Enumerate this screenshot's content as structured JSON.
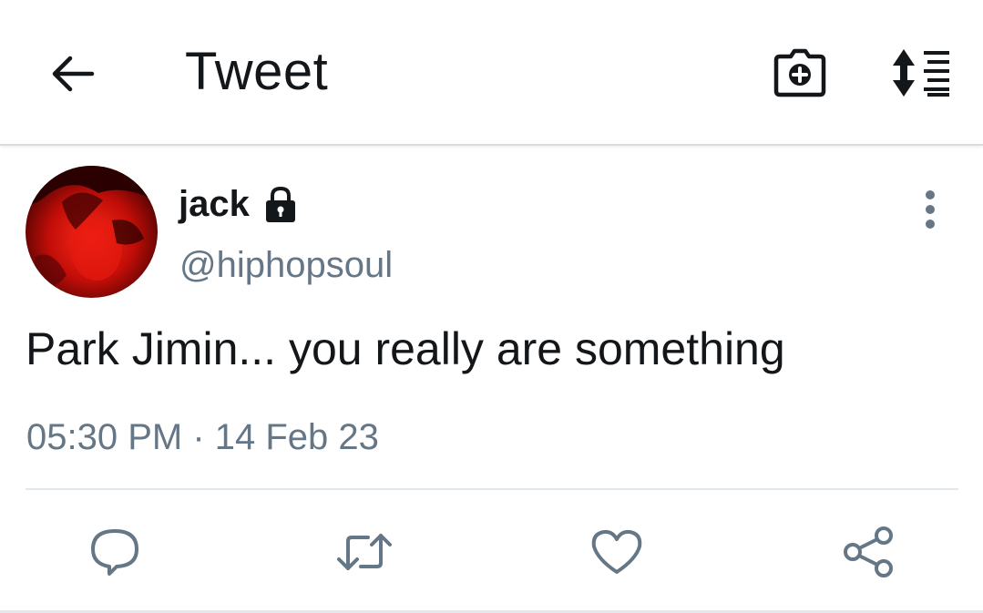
{
  "header": {
    "title": "Tweet",
    "back_icon": "arrow-left-icon",
    "camera_icon": "camera-add-icon",
    "sort_icon": "sort-lines-icon"
  },
  "tweet": {
    "author_name": "jack",
    "protected_icon": "lock-icon",
    "handle": "@hiphopsoul",
    "text": "Park Jimin... you really are something",
    "timestamp": "05:30 PM · 14 Feb 23",
    "more_icon": "vertical-dots-icon"
  },
  "actions": {
    "reply_icon": "reply-bubble-icon",
    "retweet_icon": "retweet-icon",
    "like_icon": "heart-icon",
    "share_icon": "share-icon"
  },
  "colors": {
    "text_primary": "#14171a",
    "text_secondary": "#657786",
    "icon_secondary": "#657786",
    "divider": "#e1e8ed"
  }
}
